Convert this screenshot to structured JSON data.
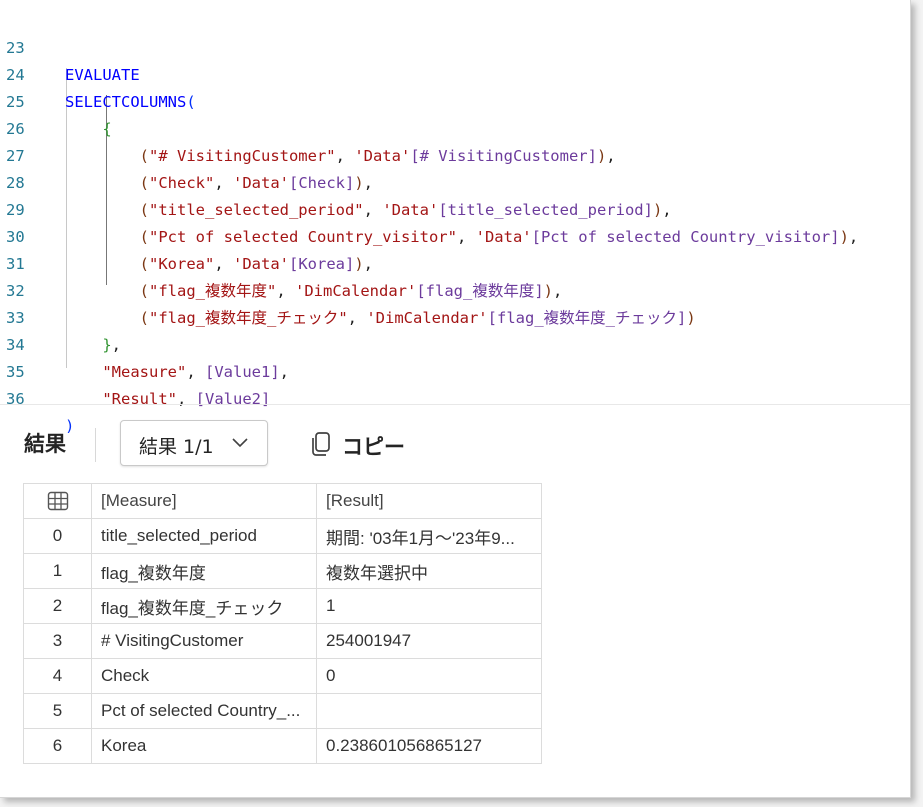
{
  "editor": {
    "line_numbers": [
      "23",
      "24",
      "25",
      "26",
      "27",
      "28",
      "29",
      "30",
      "31",
      "32",
      "33",
      "34",
      "35",
      "36"
    ],
    "kw_evaluate": "EVALUATE",
    "fn_selectcolumns": "SELECTCOLUMNS",
    "tbl_data": "'Data'",
    "tbl_dimcalendar": "'DimCalendar'",
    "rows": [
      {
        "alias": "\"# VisitingCustomer\"",
        "table": "'Data'",
        "column": "[# VisitingCustomer]"
      },
      {
        "alias": "\"Check\"",
        "table": "'Data'",
        "column": "[Check]"
      },
      {
        "alias": "\"title_selected_period\"",
        "table": "'Data'",
        "column": "[title_selected_period]"
      },
      {
        "alias": "\"Pct of selected Country_visitor\"",
        "table": "'Data'",
        "column": "[Pct of selected Country_visitor]"
      },
      {
        "alias": "\"Korea\"",
        "table": "'Data'",
        "column": "[Korea]"
      },
      {
        "alias": "\"flag_複数年度\"",
        "table": "'DimCalendar'",
        "column": "[flag_複数年度]"
      },
      {
        "alias": "\"flag_複数年度_チェック\"",
        "table": "'DimCalendar'",
        "column": "[flag_複数年度_チェック]"
      }
    ],
    "measure_alias": "\"Measure\"",
    "measure_ref": "[Value1]",
    "result_alias": "\"Result\"",
    "result_ref": "[Value2]"
  },
  "results": {
    "title": "結果",
    "dropdown_label": "結果 1/1",
    "copy_label": "コピー",
    "icons": {
      "chevron": "chevron-down-icon",
      "copy": "copy-icon",
      "grid": "table-grid-icon"
    },
    "columns": [
      "[Measure]",
      "[Result]"
    ],
    "rows": [
      {
        "index": "0",
        "measure": "title_selected_period",
        "result": "期間: '03年1月～'23年9..."
      },
      {
        "index": "1",
        "measure": "flag_複数年度",
        "result": "複数年選択中"
      },
      {
        "index": "2",
        "measure": "flag_複数年度_チェック",
        "result": "1"
      },
      {
        "index": "3",
        "measure": "# VisitingCustomer",
        "result": "254001947"
      },
      {
        "index": "4",
        "measure": "Check",
        "result": "0"
      },
      {
        "index": "5",
        "measure": "Pct of selected Country_...",
        "result": ""
      },
      {
        "index": "6",
        "measure": "Korea",
        "result": "0.238601056865127"
      }
    ]
  },
  "colors": {
    "keyword": "#0000ff",
    "string": "#a31515",
    "line_number": "#237893"
  }
}
